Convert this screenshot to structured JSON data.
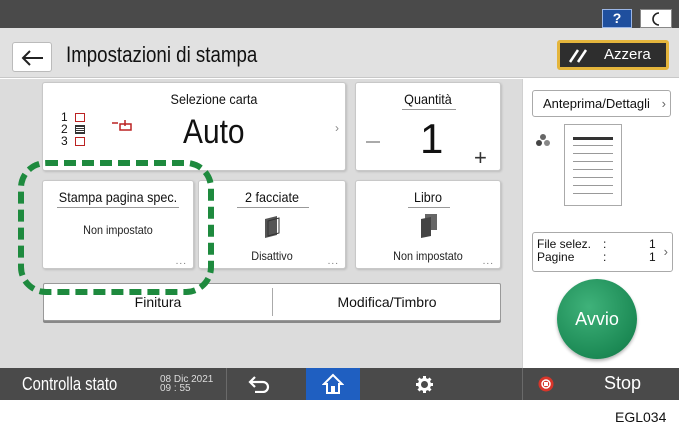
{
  "topbar": {
    "help_label": "?"
  },
  "header": {
    "title": "Impostazioni di stampa",
    "reset_label": "Azzera"
  },
  "paper": {
    "title": "Selezione carta",
    "value": "Auto",
    "trays": [
      "1",
      "2",
      "3"
    ]
  },
  "quantity": {
    "title": "Quantità",
    "value": "1"
  },
  "page_spec": {
    "title": "Stampa pagina spec.",
    "status": "Non impostato",
    "more": "..."
  },
  "duplex": {
    "title": "2 facciate",
    "status": "Disattivo",
    "more": "..."
  },
  "book": {
    "title": "Libro",
    "status": "Non impostato",
    "more": "..."
  },
  "bottom_buttons": {
    "finishing": "Finitura",
    "edit_stamp": "Modifica/Timbro"
  },
  "side": {
    "preview_label": "Anteprima/Dettagli",
    "files_label": "File selez.",
    "files_sep": ":",
    "files_value": "1",
    "pages_label": "Pagine",
    "pages_sep": ":",
    "pages_value": "1",
    "start_label": "Avvio"
  },
  "bottombar": {
    "status_label": "Controlla stato",
    "date": "08 Dic 2021",
    "time": "09 : 55",
    "stop_label": "Stop"
  },
  "figure_id": "EGL034",
  "colors": {
    "accent": "#1e8a3e",
    "start": "#1c8a55",
    "home": "#1f5fc1",
    "reset_border": "#e4b53c",
    "help": "#1f4f9e",
    "stop": "#d8352a"
  }
}
